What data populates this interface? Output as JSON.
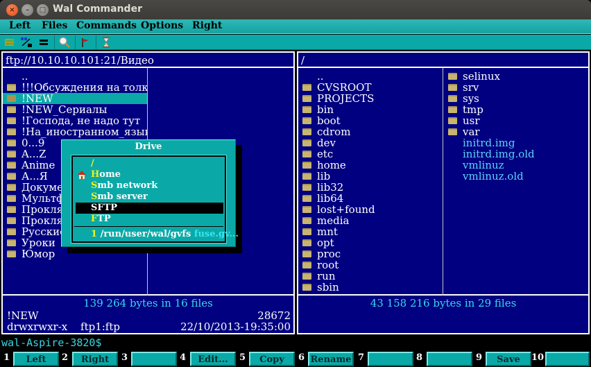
{
  "window": {
    "title": "Wal Commander",
    "controls": {
      "close": "×",
      "minimize": "–",
      "maximize": "□"
    }
  },
  "menu": [
    "Left",
    "Files",
    "Commands",
    "Options",
    "Right"
  ],
  "toolbar": [
    {
      "icon": "swap-panels-icon"
    },
    {
      "icon": "compare-panels-icon"
    },
    {
      "icon": "equal-panels-icon"
    },
    {
      "icon": "search-icon"
    },
    {
      "icon": "flag-icon"
    },
    {
      "icon": "hourglass-icon"
    }
  ],
  "left_panel": {
    "path": "ftp://10.10.10.101:21/Видео",
    "column1": [
      {
        "name": "..",
        "type": "up"
      },
      {
        "name": "!!!Обсуждения на толкучке",
        "type": "dir"
      },
      {
        "name": "!NEW",
        "type": "dir",
        "selected": true
      },
      {
        "name": "!NEW_Сериалы",
        "type": "dir"
      },
      {
        "name": "!Господа, не надо тут ",
        "type": "dir"
      },
      {
        "name": "!На_иностранном_языке",
        "type": "dir"
      },
      {
        "name": "0...9",
        "type": "dir"
      },
      {
        "name": "A...Z",
        "type": "dir"
      },
      {
        "name": "Anime",
        "type": "dir"
      },
      {
        "name": "А...Я",
        "type": "dir"
      },
      {
        "name": "Документальные",
        "type": "dir"
      },
      {
        "name": "Мультфильмы",
        "type": "dir"
      },
      {
        "name": "Проклятые",
        "type": "dir"
      },
      {
        "name": "Проклятые",
        "type": "dir"
      },
      {
        "name": "Русские",
        "type": "dir"
      },
      {
        "name": "Уроки",
        "type": "dir"
      },
      {
        "name": "Юмор",
        "type": "dir"
      }
    ],
    "column2": [],
    "summary": "139 264 bytes in 16 files",
    "info": {
      "name": "!NEW",
      "size": "28672",
      "perms": "drwxrwxr-x",
      "owner": "ftp1:ftp",
      "date": "22/10/2013-19:35:00"
    }
  },
  "right_panel": {
    "path": "/",
    "column1": [
      {
        "name": "..",
        "type": "up"
      },
      {
        "name": "CVSROOT",
        "type": "dir"
      },
      {
        "name": "PROJECTS",
        "type": "dir"
      },
      {
        "name": "bin",
        "type": "dir"
      },
      {
        "name": "boot",
        "type": "dir"
      },
      {
        "name": "cdrom",
        "type": "dir"
      },
      {
        "name": "dev",
        "type": "dir"
      },
      {
        "name": "etc",
        "type": "dir"
      },
      {
        "name": "home",
        "type": "dir"
      },
      {
        "name": "lib",
        "type": "dir"
      },
      {
        "name": "lib32",
        "type": "dir"
      },
      {
        "name": "lib64",
        "type": "dir"
      },
      {
        "name": "lost+found",
        "type": "dir"
      },
      {
        "name": "media",
        "type": "dir"
      },
      {
        "name": "mnt",
        "type": "dir"
      },
      {
        "name": "opt",
        "type": "dir"
      },
      {
        "name": "proc",
        "type": "dir"
      },
      {
        "name": "root",
        "type": "dir"
      },
      {
        "name": "run",
        "type": "dir"
      },
      {
        "name": "sbin",
        "type": "dir"
      }
    ],
    "column2": [
      {
        "name": "selinux",
        "type": "dir"
      },
      {
        "name": "srv",
        "type": "dir"
      },
      {
        "name": "sys",
        "type": "dir"
      },
      {
        "name": "tmp",
        "type": "dir"
      },
      {
        "name": "usr",
        "type": "dir"
      },
      {
        "name": "var",
        "type": "dir"
      },
      {
        "name": "initrd.img",
        "type": "file"
      },
      {
        "name": "initrd.img.old",
        "type": "file"
      },
      {
        "name": "vmlinuz",
        "type": "file"
      },
      {
        "name": "vmlinuz.old",
        "type": "file"
      }
    ],
    "summary": "43 158 216 bytes in 29 files"
  },
  "drive_dialog": {
    "title": "Drive",
    "items": [
      {
        "hot": "/",
        "rest": "",
        "icon": null
      },
      {
        "hot": "H",
        "rest": "ome",
        "icon": "home-icon"
      },
      {
        "hot": "S",
        "rest": "mb network",
        "icon": null
      },
      {
        "hot": "S",
        "rest": "mb server",
        "icon": null
      },
      {
        "hot": "",
        "rest": "SFTP",
        "icon": null,
        "selected": true
      },
      {
        "hot": "F",
        "rest": "TP",
        "icon": null
      }
    ],
    "mount": {
      "num": "1",
      "path": "/run/user/wal/gvfs",
      "fs": "fuse.gv..."
    }
  },
  "command_line": {
    "prompt": "wal-Aspire-3820$"
  },
  "function_keys": [
    {
      "num": "1",
      "label": "Left"
    },
    {
      "num": "2",
      "label": "Right"
    },
    {
      "num": "3",
      "label": ""
    },
    {
      "num": "4",
      "label": "Edit..."
    },
    {
      "num": "5",
      "label": "Copy"
    },
    {
      "num": "6",
      "label": "Rename"
    },
    {
      "num": "7",
      "label": ""
    },
    {
      "num": "8",
      "label": ""
    },
    {
      "num": "9",
      "label": "Save"
    },
    {
      "num": "10",
      "label": ""
    }
  ]
}
